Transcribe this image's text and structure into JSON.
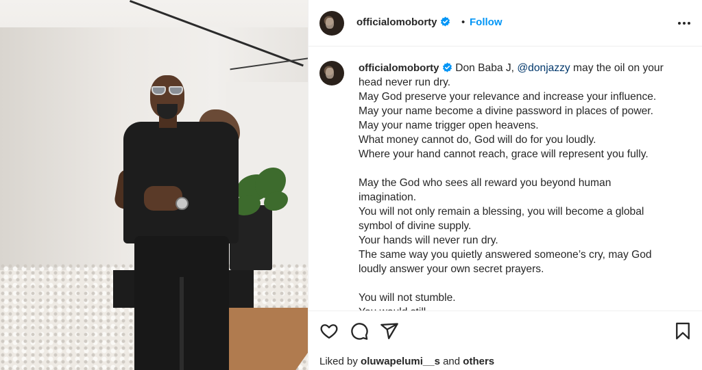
{
  "post": {
    "photo_alt": "photo",
    "author": "officialomoborty",
    "follow_label": "Follow",
    "separator": "•",
    "caption": {
      "username": "officialomoborty",
      "lead": " Don Baba J, ",
      "mention": "@donjazzy",
      "after_mention": " may the oil on your",
      "lines": [
        "head never run dry.",
        "May God preserve your relevance and increase your influence.",
        "May your name become a divine password in places of power.",
        "May your name trigger open heavens.",
        "What money cannot do, God will do for you loudly.",
        "Where your hand cannot reach, grace will represent you fully."
      ],
      "para2": [
        "May the God who sees all reward you beyond human",
        "imagination.",
        "You will not only remain a blessing, you will become a global",
        "symbol of divine supply.",
        "Your hands will never run dry.",
        "The same way you quietly answered someone’s cry, may God",
        "loudly answer your own secret prayers."
      ],
      "para3": [
        "You will not stumble."
      ],
      "cut_line": "You would still"
    },
    "likes": {
      "prefix": "Liked by ",
      "user": "oluwapelumi__s",
      "middle": " and ",
      "others": "others"
    }
  },
  "icons": {
    "like": "heart-icon",
    "comment": "comment-icon",
    "share": "paper-plane-icon",
    "save": "bookmark-icon",
    "more": "more-options-icon",
    "verified": "verified-badge-icon"
  },
  "colors": {
    "accent": "#0095f6",
    "verified": "#0095f6",
    "mention": "#00376b",
    "text": "#262626"
  }
}
